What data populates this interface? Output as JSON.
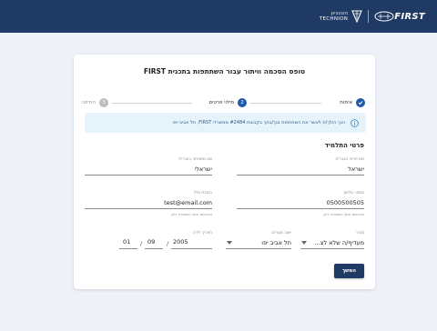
{
  "header": {
    "technion_line1": "הטכניון",
    "technion_line2": "TECHNION",
    "first_word": "FIRST",
    "first_sub": "ISRAEL"
  },
  "form": {
    "title": "טופס הסכמה וויתור עבור השתתפות בתכנית FIRST",
    "steps": [
      {
        "number": "1",
        "label": "אימות",
        "state": "done",
        "icon": "check-icon"
      },
      {
        "number": "2",
        "label": "מילוי פרטים",
        "state": "active"
      },
      {
        "number": "3",
        "label": "חתימה",
        "state": "pending"
      }
    ],
    "info_text": "הנך הולך/ת לאשר את השתתפות בנך/בתך בקבוצת #2484 ממשרדי FIRST, תל אביב-יפו",
    "section_title": "פרטי התלמיד",
    "fields": {
      "first_name": {
        "label": "שם פרטי בעברית",
        "value": "ישראל"
      },
      "last_name": {
        "label": "שם משפחה בעברית",
        "value": "ישראלי"
      },
      "phone": {
        "label": "מספר טלפון",
        "value": "0500500505",
        "helper": "בפורמט חוקי השמירה ריק"
      },
      "email": {
        "label": "כתובת מייל",
        "value": "test@email.com",
        "helper": "בפורמט חוקי השמירה ריק"
      },
      "gender": {
        "label": "מגדר",
        "value": "מעדיף/ה שלא לצ..."
      },
      "city": {
        "label": "ישוב מגורים",
        "value": "תל אביב יפו"
      },
      "birthdate": {
        "label": "תאריך לידה",
        "year": "2005",
        "month": "09",
        "day": "01",
        "separator": "/"
      }
    },
    "continue_label": "המשך"
  },
  "colors": {
    "header_bg": "#1f3a64",
    "primary": "#1f5ba8",
    "info_bg": "#e7f3fb",
    "info_text": "#2d5e88",
    "page_bg": "#eef1f7"
  }
}
